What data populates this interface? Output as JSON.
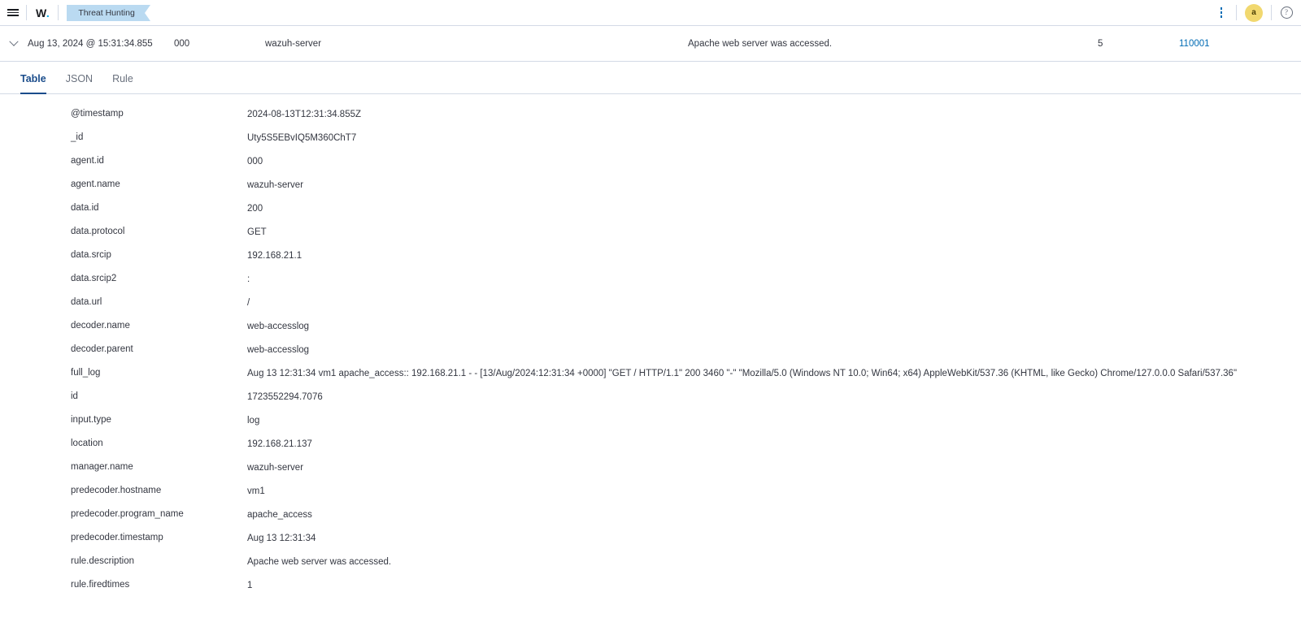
{
  "chrome": {
    "menu_icon": "hamburger-menu-icon",
    "brand": "W",
    "brand_dot": ".",
    "breadcrumb": "Threat Hunting",
    "actions_icon": "vertical-dots-icon",
    "avatar_initial": "a",
    "help_icon": "help-question-icon",
    "accent_color": "#006bb4",
    "breadcrumb_bg": "#badaf1",
    "avatar_bg": "#f1d86f"
  },
  "doc_header": {
    "expand_icon": "chevron-down-icon",
    "timestamp": "Aug 13, 2024 @ 15:31:34.855",
    "agent_id": "000",
    "agent_name": "wazuh-server",
    "rule_description": "Apache web server was accessed.",
    "rule_level": "5",
    "rule_id": "110001"
  },
  "tabs": [
    {
      "label": "Table",
      "active": true
    },
    {
      "label": "JSON",
      "active": false
    },
    {
      "label": "Rule",
      "active": false
    }
  ],
  "fields": [
    {
      "name": "@timestamp",
      "value": "2024-08-13T12:31:34.855Z"
    },
    {
      "name": "_id",
      "value": "Uty5S5EBvIQ5M360ChT7"
    },
    {
      "name": "agent.id",
      "value": "000"
    },
    {
      "name": "agent.name",
      "value": "wazuh-server"
    },
    {
      "name": "data.id",
      "value": "200"
    },
    {
      "name": "data.protocol",
      "value": "GET"
    },
    {
      "name": "data.srcip",
      "value": "192.168.21.1"
    },
    {
      "name": "data.srcip2",
      "value": ":"
    },
    {
      "name": "data.url",
      "value": "/"
    },
    {
      "name": "decoder.name",
      "value": "web-accesslog"
    },
    {
      "name": "decoder.parent",
      "value": "web-accesslog"
    },
    {
      "name": "full_log",
      "value": "Aug 13 12:31:34 vm1 apache_access:: 192.168.21.1 - - [13/Aug/2024:12:31:34 +0000] \"GET / HTTP/1.1\" 200 3460 \"-\" \"Mozilla/5.0 (Windows NT 10.0; Win64; x64) AppleWebKit/537.36 (KHTML, like Gecko) Chrome/127.0.0.0 Safari/537.36\""
    },
    {
      "name": "id",
      "value": "1723552294.7076"
    },
    {
      "name": "input.type",
      "value": "log"
    },
    {
      "name": "location",
      "value": "192.168.21.137"
    },
    {
      "name": "manager.name",
      "value": "wazuh-server"
    },
    {
      "name": "predecoder.hostname",
      "value": "vm1"
    },
    {
      "name": "predecoder.program_name",
      "value": "apache_access"
    },
    {
      "name": "predecoder.timestamp",
      "value": "Aug 13 12:31:34"
    },
    {
      "name": "rule.description",
      "value": "Apache web server was accessed."
    },
    {
      "name": "rule.firedtimes",
      "value": "1"
    }
  ]
}
